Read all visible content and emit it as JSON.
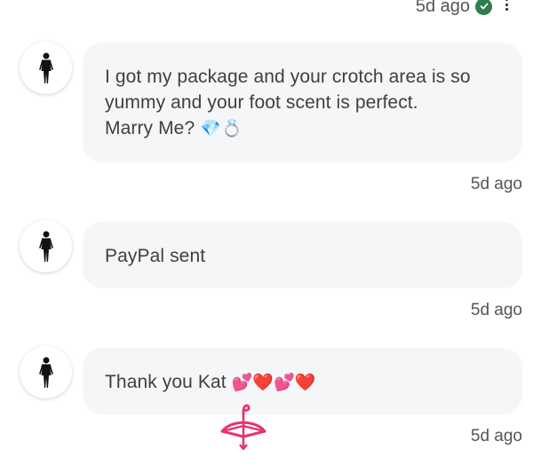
{
  "header": {
    "timestamp": "5d ago",
    "verified_icon": "check-circle-icon",
    "more_icon": "more-vertical-icon"
  },
  "messages": [
    {
      "avatar_icon": "woman-figure-icon",
      "text_line1": "I got my package and your crotch area is so",
      "text_line2": "yummy and your foot scent is perfect.",
      "text_line3": "Marry Me?",
      "emoji": "💎💍",
      "timestamp": "5d ago"
    },
    {
      "avatar_icon": "woman-figure-icon",
      "text": "PayPal sent",
      "timestamp": "5d ago"
    },
    {
      "avatar_icon": "woman-figure-icon",
      "text": "Thank you Kat",
      "emoji": "💕❤️💕❤️",
      "timestamp": "5d ago"
    }
  ],
  "colors": {
    "bubble_bg": "#f5f6f8",
    "accent_check": "#2e7d4f",
    "watermark": "#e8336d"
  }
}
